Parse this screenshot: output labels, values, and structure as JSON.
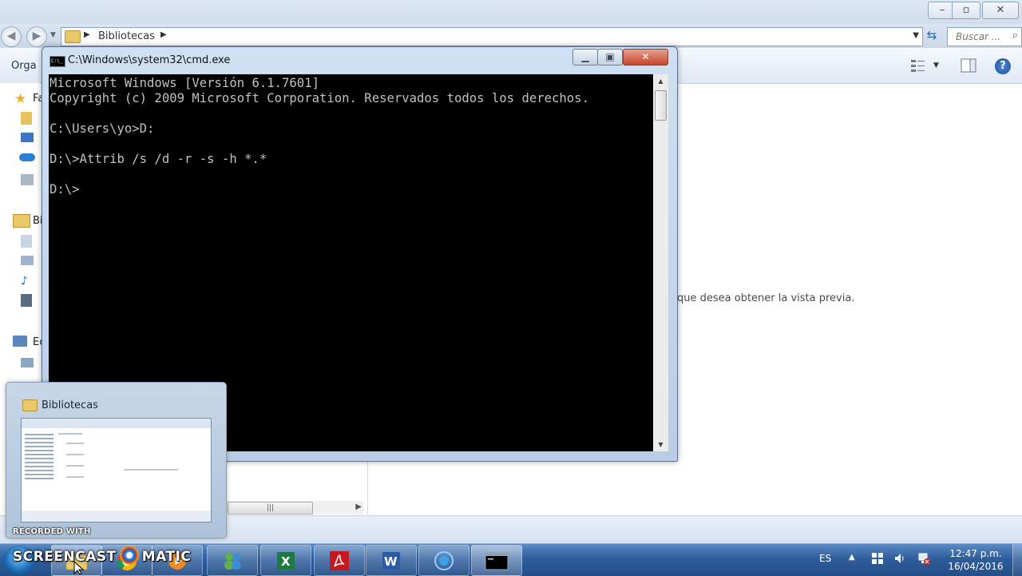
{
  "explorer": {
    "breadcrumb": "Bibliotecas",
    "search_placeholder": "Buscar ...",
    "toolbar_organize": "Orga",
    "nav_labels": [
      "Fa",
      "Bi",
      "Ec"
    ],
    "preview_message": "que desea obtener la vista previa.",
    "hscroll_grip": "|||"
  },
  "cmd": {
    "title": "C:\\Windows\\system32\\cmd.exe",
    "icon_text": "C:\\_",
    "console_text": "Microsoft Windows [Versión 6.1.7601]\nCopyright (c) 2009 Microsoft Corporation. Reservados todos los derechos.\n\nC:\\Users\\yo>D:\n\nD:\\>Attrib /s /d -r -s -h *.*\n\nD:\\>"
  },
  "thumbnail": {
    "title": "Bibliotecas"
  },
  "watermark": {
    "recorded_with": "RECORDED WITH",
    "brand_left": "SCREENCAST",
    "brand_right": "MATIC"
  },
  "taskbar": {
    "language": "ES",
    "time": "12:47 p.m.",
    "date": "16/04/2016",
    "apps": [
      "windows-explorer",
      "chrome",
      "media-player",
      "messenger",
      "excel",
      "adobe-reader",
      "word",
      "media-center",
      "cmd"
    ]
  },
  "colors": {
    "console_bg": "#000000",
    "console_fg": "#c0c0c0",
    "taskbar_blue": "#2f5e9c",
    "close_red": "#c7452b"
  }
}
